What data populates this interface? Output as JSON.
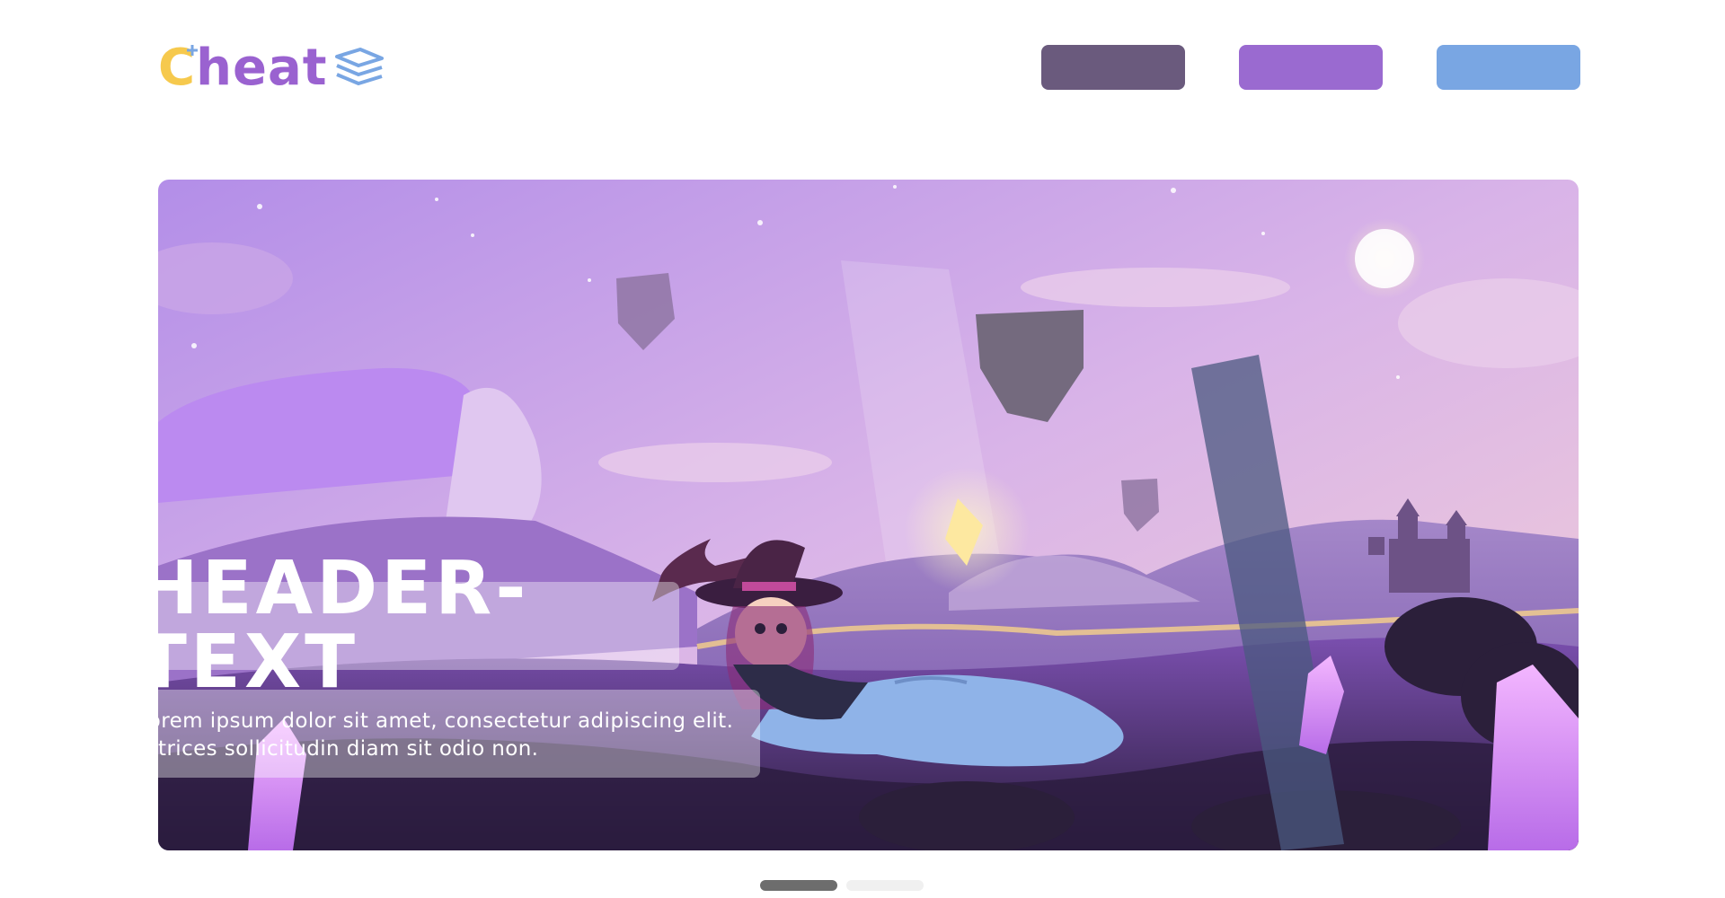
{
  "logo": {
    "brand_first": "C",
    "brand_rest": "heat",
    "brand_color": "#9a62d0",
    "accent_color": "#f6c94d",
    "icon": "stack-layers-icon"
  },
  "nav": {
    "buttons": [
      {
        "label": "",
        "color": "#6a5a7d"
      },
      {
        "label": "",
        "color": "#9a6ad0"
      },
      {
        "label": "",
        "color": "#79a6e3"
      }
    ]
  },
  "hero": {
    "title": "HEADER-TEXT",
    "subtitle_line1": "Lorem ipsum dolor sit amet, consectetur adipiscing elit.",
    "subtitle_line2": "Ultrices sollicitudin diam sit odio non.",
    "illustration": "witch-fantasy-landscape"
  },
  "carousel": {
    "active_index": 0,
    "count": 2,
    "active_color": "#6d6d6d",
    "inactive_color": "#f0f0f0"
  }
}
